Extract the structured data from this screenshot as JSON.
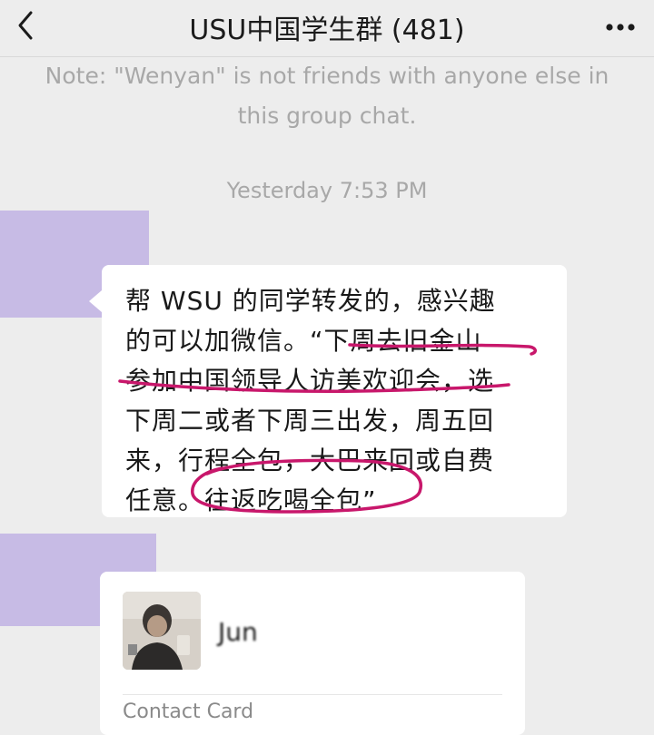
{
  "header": {
    "title": "USU中国学生群 (481)",
    "back_icon": "chevron-left-icon",
    "more_icon": "more-horizontal-icon"
  },
  "system_note": {
    "line1": "Note: \"Wenyan\" is not friends with anyone else in",
    "line2": "this group chat."
  },
  "timestamp": "Yesterday 7:53 PM",
  "message": {
    "lines": [
      "帮 WSU 的同学转发的，感兴趣",
      "的可以加微信。“下周去旧金山",
      "参加中国领导人访美欢迎会，选",
      "下周二或者下周三出发，周五回",
      "来，行程全包，大巴来回或自费",
      "任意。往返吃喝全包”"
    ]
  },
  "contact_card": {
    "name": "Jun",
    "label": "Contact Card"
  },
  "colors": {
    "background": "#ededed",
    "bubble": "#ffffff",
    "avatar_placeholder": "#c7bbe5",
    "annotation": "#c8176b"
  }
}
